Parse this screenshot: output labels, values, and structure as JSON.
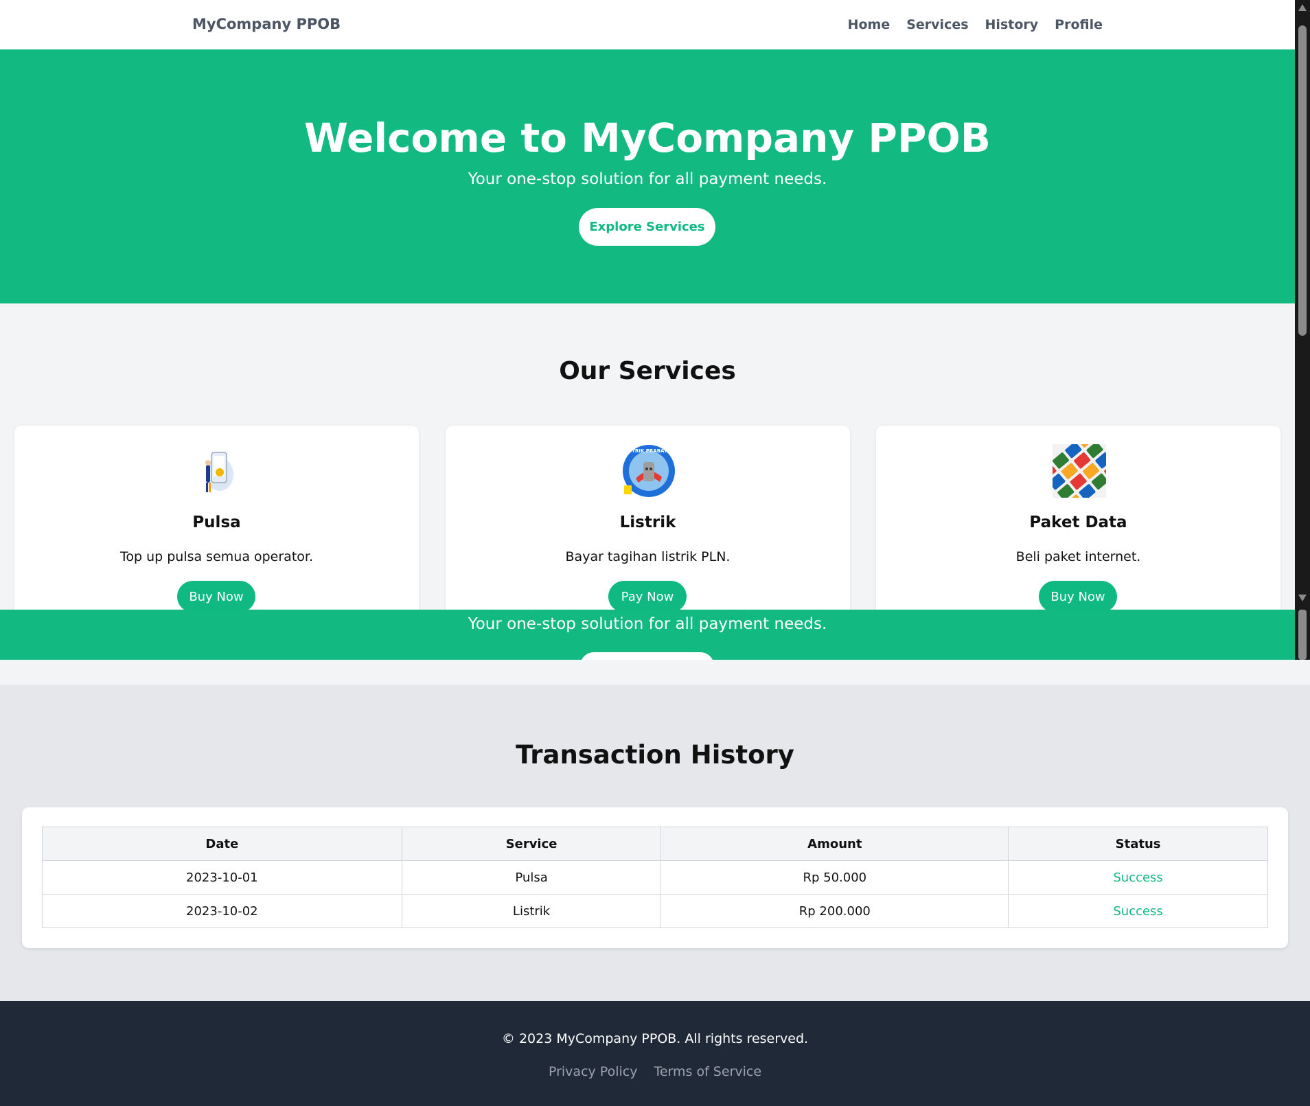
{
  "navbar": {
    "brand": "MyCompany PPOB",
    "links": [
      "Home",
      "Services",
      "History",
      "Profile"
    ]
  },
  "hero": {
    "title": "Welcome to MyCompany PPOB",
    "subtitle": "Your one-stop solution for all payment needs.",
    "cta": "Explore Services"
  },
  "services": {
    "heading": "Our Services",
    "cards": [
      {
        "title": "Pulsa",
        "description": "Top up pulsa semua operator.",
        "button": "Buy Now",
        "icon": "phone-topup-icon"
      },
      {
        "title": "Listrik",
        "description": "Bayar tagihan listrik PLN.",
        "button": "Pay Now",
        "icon": "listrik-prabayar-logo",
        "logo_text": "LISTRIK PRABAYAR"
      },
      {
        "title": "Paket Data",
        "description": "Beli paket internet.",
        "button": "Buy Now",
        "icon": "sim-cards-icon"
      }
    ]
  },
  "hero_strip": {
    "subtitle": "Your one-stop solution for all payment needs."
  },
  "history": {
    "heading": "Transaction History",
    "columns": [
      "Date",
      "Service",
      "Amount",
      "Status"
    ],
    "rows": [
      {
        "date": "2023-10-01",
        "service": "Pulsa",
        "amount": "Rp 50.000",
        "status": "Success"
      },
      {
        "date": "2023-10-02",
        "service": "Listrik",
        "amount": "Rp 200.000",
        "status": "Success"
      }
    ]
  },
  "footer": {
    "copyright": "© 2023 MyCompany PPOB. All rights reserved.",
    "links": [
      "Privacy Policy",
      "Terms of Service"
    ]
  },
  "colors": {
    "accent": "#10b981",
    "footer_bg": "#1f2937",
    "section_bg": "#f3f4f6"
  }
}
